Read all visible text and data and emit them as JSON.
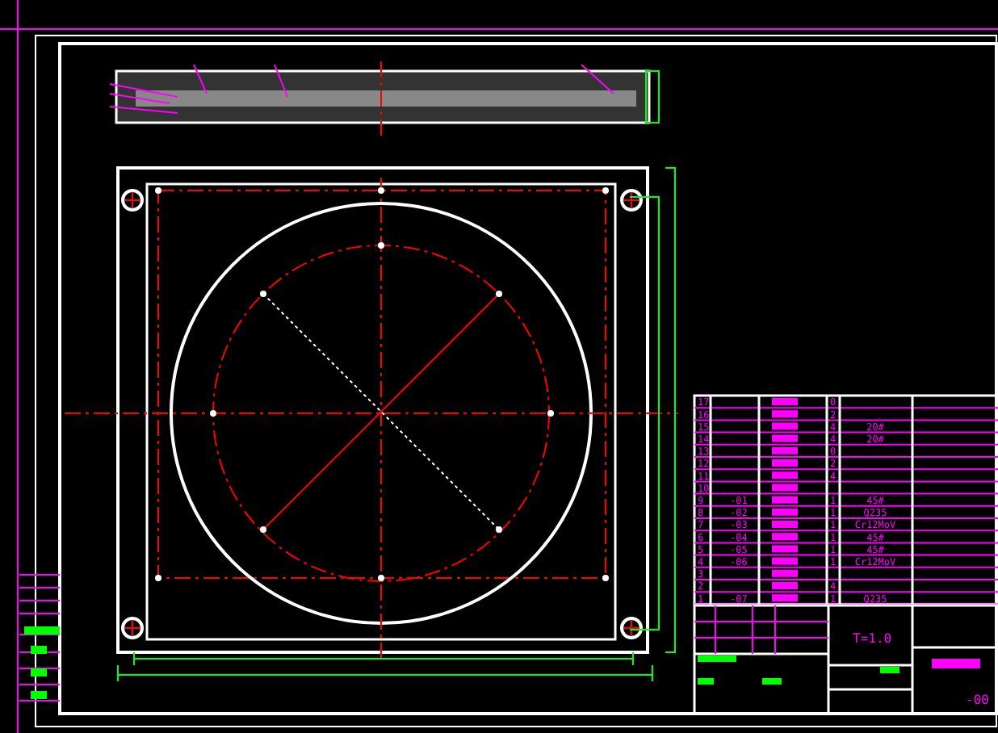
{
  "drawing": {
    "parts_list": [
      {
        "no": "17",
        "qty": "0"
      },
      {
        "no": "16",
        "qty": "2"
      },
      {
        "no": "15",
        "qty": "4",
        "material": "20#"
      },
      {
        "no": "14",
        "qty": "4",
        "material": "20#"
      },
      {
        "no": "13",
        "qty": "0"
      },
      {
        "no": "12",
        "qty": "2"
      },
      {
        "no": "11",
        "qty": "4"
      },
      {
        "no": "10"
      },
      {
        "no": "9",
        "part_no": "-01",
        "qty": "1",
        "material": "45#"
      },
      {
        "no": "8",
        "part_no": "-02",
        "qty": "1",
        "material": "Q235"
      },
      {
        "no": "7",
        "part_no": "-03",
        "qty": "1",
        "material": "Cr12MoV"
      },
      {
        "no": "6",
        "part_no": "-04",
        "qty": "1",
        "material": "45#"
      },
      {
        "no": "5",
        "part_no": "-05",
        "qty": "1",
        "material": "45#"
      },
      {
        "no": "4",
        "part_no": "-06",
        "qty": "1",
        "material": "Cr12MoV"
      },
      {
        "no": "3"
      },
      {
        "no": "2",
        "qty": "4"
      },
      {
        "no": "1",
        "part_no": "-07",
        "qty": "1",
        "material": "Q235"
      }
    ],
    "title_block": {
      "thickness": "T=1.0",
      "drawing_no": "-00"
    }
  }
}
